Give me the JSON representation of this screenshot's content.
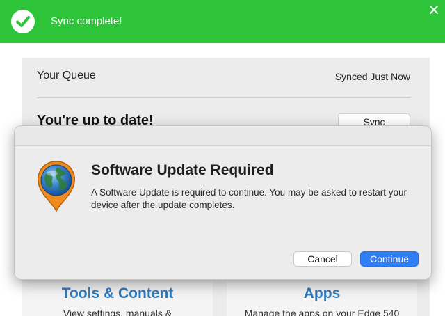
{
  "banner": {
    "message": "Sync complete!",
    "color": "#2ec43a"
  },
  "queue": {
    "title": "Your Queue",
    "status": "Synced Just Now",
    "headline": "You're up to date!",
    "sync_label": "Sync"
  },
  "cards": [
    {
      "title": "Tools & Content",
      "subtitle": "View settings, manuals &"
    },
    {
      "title": "Apps",
      "subtitle": "Manage the apps on your Edge 540"
    }
  ],
  "dialog": {
    "title": "Software Update Required",
    "body": "A Software Update is required to continue. You may be asked to restart your device after the update completes.",
    "cancel_label": "Cancel",
    "continue_label": "Continue",
    "accent": "#2f7ef6",
    "icon": "globe-pin-icon"
  }
}
